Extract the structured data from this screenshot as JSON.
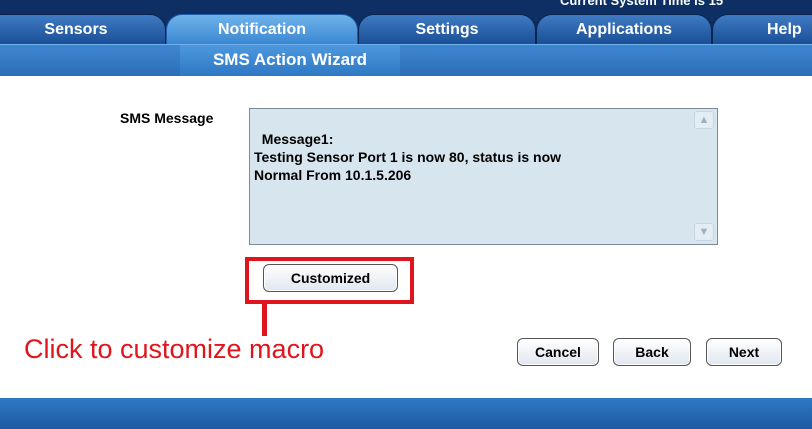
{
  "header": {
    "system_line": "Current System Time is 15",
    "tabs": [
      {
        "label": "Sensors",
        "active": false
      },
      {
        "label": "Notification",
        "active": true
      },
      {
        "label": "Settings",
        "active": false
      },
      {
        "label": "Applications",
        "active": false
      },
      {
        "label": "Help",
        "active": false
      }
    ]
  },
  "page": {
    "title": "SMS Action Wizard"
  },
  "form": {
    "sms_label": "SMS Message",
    "sms_value": "Message1:\nTesting Sensor Port 1 is now 80, status is now\nNormal From 10.1.5.206",
    "customized_label": "Customized"
  },
  "buttons": {
    "cancel": "Cancel",
    "back": "Back",
    "next": "Next"
  },
  "annotation": {
    "text": "Click to customize macro",
    "color": "#e0141c"
  },
  "colors": {
    "nav_dark": "#0d2f64",
    "tab_active": "#3a87d2",
    "subbar": "#2c6eb8",
    "textarea_bg": "#d7e6ee"
  }
}
